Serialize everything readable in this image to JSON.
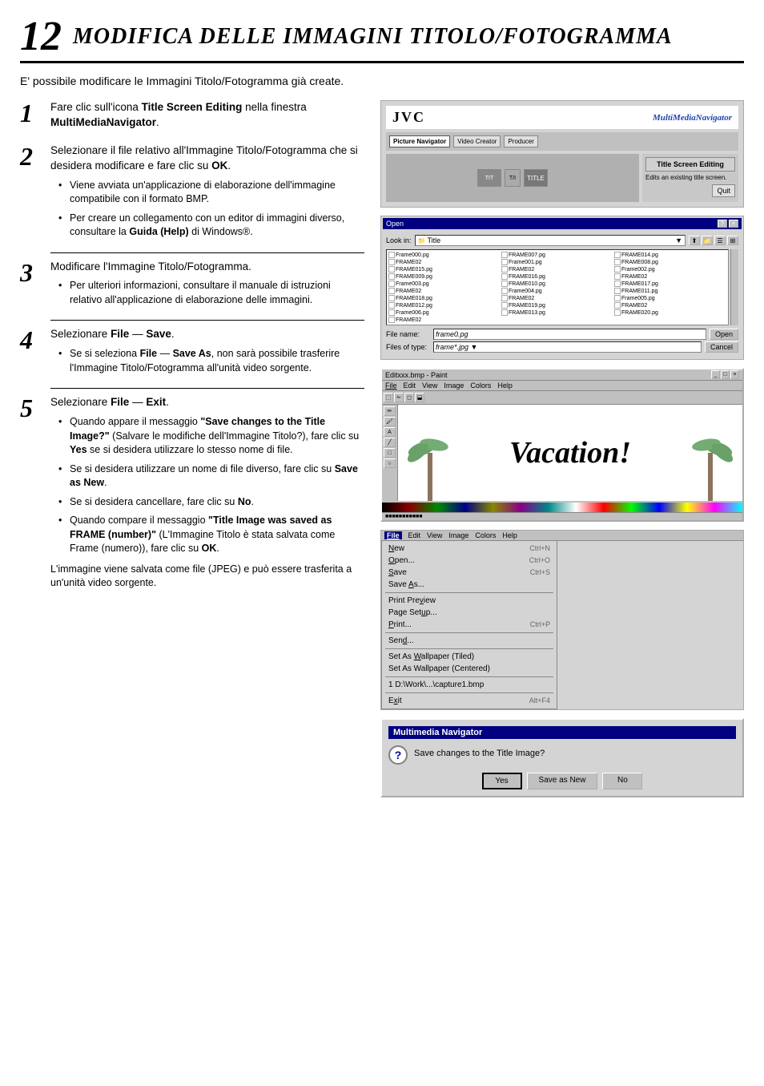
{
  "page": {
    "number": "12",
    "title": "MODIFICA DELLE IMMAGINI TITOLO/FOTOGRAMMA",
    "intro": "E' possibile modificare le Immagini Titolo/Fotogramma già create."
  },
  "steps": [
    {
      "number": "1",
      "text": "Fare clic sull'icona <strong>Title Screen Editing</strong> nella finestra <strong>MultiMediaNavigator</strong>.",
      "bullets": []
    },
    {
      "number": "2",
      "text": "Selezionare il file relativo all'Immagine Titolo/Fotogramma che si desidera modificare e fare clic su <strong>OK</strong>.",
      "bullets": [
        "Viene avviata un'applicazione di elaborazione dell'immagine compatibile con il formato BMP.",
        "Per creare un collegamento con un editor di immagini diverso, consultare la <strong>Guida (Help)</strong> di Windows®."
      ]
    },
    {
      "number": "3",
      "text": "Modificare l'Immagine Titolo/Fotogramma.",
      "bullets": [
        "Per ulteriori informazioni, consultare il manuale di istruzioni relativo all'applicazione di elaborazione delle immagini."
      ]
    },
    {
      "number": "4",
      "text": "Selezionare <strong>File</strong> — <strong>Save</strong>.",
      "bullets": [
        "Se si seleziona <strong>File</strong> — <strong>Save As</strong>, non sarà possibile trasferire l'Immagine Titolo/Fotogramma all'unità video sorgente."
      ]
    },
    {
      "number": "5",
      "text": "Selezionare <strong>File</strong> — <strong>Exit</strong>.",
      "bullets": [
        "Quando appare il messaggio <strong>\"Save changes to the Title Image?\"</strong> (Salvare le modifiche dell'Immagine Titolo?), fare clic su <strong>Yes</strong> se si desidera utilizzare lo stesso nome di file.",
        "Se si desidera utilizzare un nome di file diverso, fare clic su <strong>Save as New</strong>.",
        "Se si desidera cancellare, fare clic su <strong>No</strong>.",
        "Quando compare il messaggio <strong>\"Title Image was saved as FRAME (number)\"</strong> (L'Immagine Titolo è stata salvata come Frame (numero)), fare clic su <strong>OK</strong>."
      ]
    }
  ],
  "step5_footer": "L'immagine viene salvata come file (JPEG) e può essere trasferita a un'unità video sorgente.",
  "jvc_nav": {
    "logo": "JVC",
    "app_name": "MultiMediaNavigator",
    "screen_editing_btn": "Title Screen Editing",
    "description": "Edits an existing title screen.",
    "quit_btn": "Quit",
    "nav_icons": [
      "Picture Navigator",
      "Video Creator",
      "Producer"
    ]
  },
  "open_dialog": {
    "title": "Open",
    "lookin_label": "Look in:",
    "lookin_value": "Title",
    "filename_label": "File name:",
    "filename_value": "frame0.pg",
    "filetype_label": "Files of type:",
    "filetype_value": "frame*.jpg",
    "open_btn": "Open",
    "cancel_btn": "Cancel",
    "files": [
      "Frame000.pg",
      "Frame001.pg",
      "Frame002.pg",
      "Frame003.pg",
      "Frame004.pg",
      "Frame005.pg",
      "Frame006.pg",
      "FRAME007.pg",
      "FRAME008.pg",
      "FRAME009.pg",
      "FRAME010.pg",
      "FRAME011.pg",
      "FRAME012.pg",
      "FRAME013.pg",
      "FRAME014.pg",
      "FRAME015.pg",
      "FRAME016.pg",
      "FRAME017.pg",
      "FRAME018.pg",
      "FRAME019.pg",
      "FRAME020.pg",
      "FRAME0",
      "FRAME0",
      "FRAME0",
      "FRAME0",
      "FRAME0",
      "FRAME0",
      "FRAME0"
    ]
  },
  "paint": {
    "title": "Editxxx.bmp - Paint",
    "menus": [
      "File",
      "Edit",
      "View",
      "Image",
      "Colors",
      "Help"
    ],
    "canvas_text": "Vacation!",
    "statusbar": ""
  },
  "file_menu": {
    "title": "File",
    "items": [
      {
        "label": "New",
        "shortcut": "Ctrl+N"
      },
      {
        "label": "Open...",
        "shortcut": "Ctrl+O"
      },
      {
        "label": "Save",
        "shortcut": "Ctrl+S"
      },
      {
        "label": "Save As...",
        "shortcut": ""
      },
      {
        "separator": true
      },
      {
        "label": "Print Preview",
        "shortcut": ""
      },
      {
        "label": "Page Setup...",
        "shortcut": ""
      },
      {
        "label": "Print...",
        "shortcut": "Ctrl+P"
      },
      {
        "separator": true
      },
      {
        "label": "Send...",
        "shortcut": ""
      },
      {
        "separator": true
      },
      {
        "label": "Set As Wallpaper (Tiled)",
        "shortcut": ""
      },
      {
        "label": "Set As Wallpaper (Centered)",
        "shortcut": ""
      },
      {
        "separator": true
      },
      {
        "label": "1 D:\\Work\\...\\capture1.bmp",
        "shortcut": ""
      },
      {
        "separator": true
      },
      {
        "label": "Exit",
        "shortcut": "Alt+F4"
      }
    ]
  },
  "mm_dialog": {
    "title": "Multimedia Navigator",
    "message": "Save changes to the Title Image?",
    "yes_btn": "Yes",
    "save_new_btn": "Save as New",
    "no_btn": "No"
  }
}
